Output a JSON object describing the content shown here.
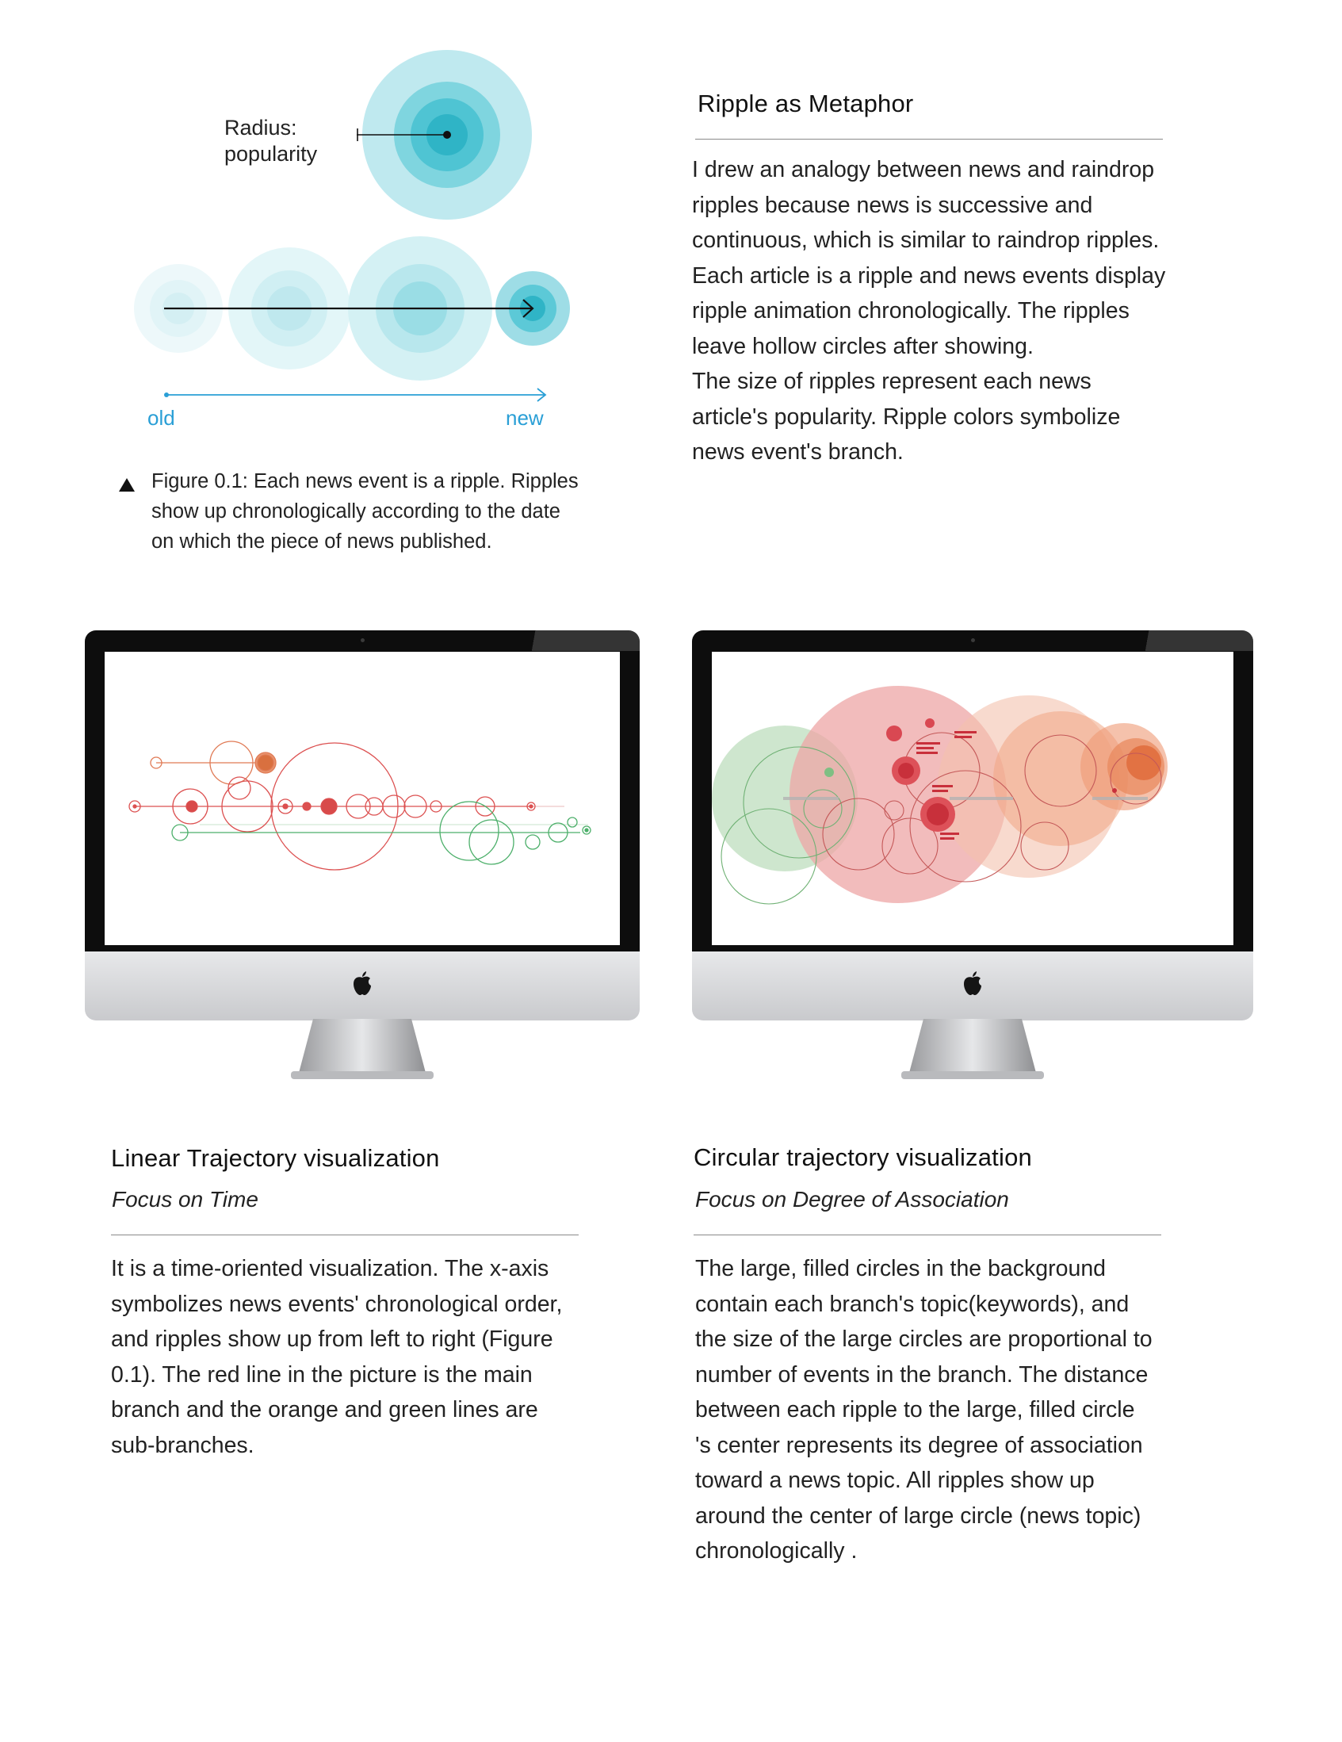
{
  "diagram": {
    "radius_label_line1": "Radius:",
    "radius_label_line2": "popularity",
    "axis_old": "old",
    "axis_new": "new",
    "colors": {
      "ripple_dark": "#3cc3d2",
      "ripple_light": "#d9f3f6",
      "axis": "#2a9fd6"
    }
  },
  "caption": {
    "icon": "triangle-up-icon",
    "line1": "Figure 0.1: Each news event is a ripple. Ripples",
    "line2": "show up chronologically according to the date",
    "line3": "on which the piece of news published."
  },
  "metaphor": {
    "title": "Ripple as Metaphor",
    "lines": [
      "I drew an analogy between news and raindrop",
      "ripples because news is successive and",
      "continuous, which is similar to raindrop ripples.",
      "Each article is a ripple and news events display",
      "ripple animation chronologically. The ripples",
      "leave hollow circles after showing.",
      "The size of ripples represent each news",
      "article's popularity. Ripple colors symbolize",
      "news event's branch."
    ]
  },
  "linear": {
    "title": "Linear Trajectory visualization",
    "subtitle": "Focus on Time",
    "lines": [
      "It is a time-oriented visualization. The x-axis",
      "symbolizes news events' chronological order,",
      "and ripples show up from left to right (Figure",
      "0.1). The red line in the picture is the main",
      "branch and the orange and green lines are",
      "sub-branches."
    ],
    "colors": {
      "main": "#dc5050",
      "orange": "#e07a55",
      "green": "#4caf6a"
    }
  },
  "circular": {
    "title": "Circular trajectory visualization",
    "subtitle": "Focus on Degree of Association",
    "lines": [
      "The large, filled circles in the background",
      "contain each branch's topic(keywords), and",
      "the size of the large circles are proportional to",
      "number of events in the branch. The distance",
      "between each ripple to the large, filled circle",
      "'s center represents its degree of association",
      "toward a news topic. All ripples show up",
      "around the center of large circle (news topic)",
      "chronologically ."
    ],
    "colors": {
      "red": "#e8999b",
      "green": "#b9dcb9",
      "orange": "#f0a583"
    }
  },
  "monitor": {
    "logo_icon": "apple-logo-icon"
  }
}
